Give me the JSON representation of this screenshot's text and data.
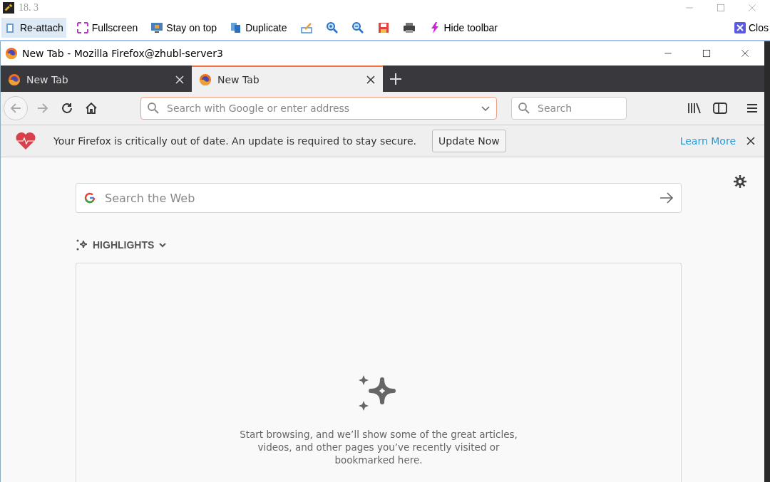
{
  "outer_window": {
    "title": "18. 3"
  },
  "toolbar": {
    "items": [
      {
        "label": "Re-attach",
        "kind": "labeled",
        "highlighted": true
      },
      {
        "label": "Fullscreen",
        "kind": "labeled",
        "highlighted": false
      },
      {
        "label": "Stay on top",
        "kind": "labeled",
        "highlighted": false
      },
      {
        "label": "Duplicate",
        "kind": "labeled",
        "highlighted": false
      },
      {
        "kind": "icon",
        "highlighted": false
      },
      {
        "kind": "icon",
        "highlighted": false
      },
      {
        "kind": "icon",
        "highlighted": false
      },
      {
        "kind": "icon",
        "highlighted": false
      },
      {
        "kind": "icon",
        "highlighted": false
      },
      {
        "label": "Hide toolbar",
        "kind": "labeled",
        "highlighted": false
      }
    ],
    "close_label": "Clos"
  },
  "window": {
    "title": "New Tab - Mozilla Firefox@zhubl-server3"
  },
  "tabs": [
    {
      "label": "New Tab",
      "selected": false
    },
    {
      "label": "New Tab",
      "selected": true
    }
  ],
  "address_bar": {
    "placeholder": "Search with Google or enter address"
  },
  "search_bar": {
    "placeholder": "Search"
  },
  "notification": {
    "message": "Your Firefox is critically out of date. An update is required to stay secure.",
    "button": "Update Now",
    "link": "Learn More"
  },
  "content": {
    "web_search": {
      "placeholder": "Search the Web"
    },
    "highlights": {
      "title": "HIGHLIGHTS",
      "expanded": true,
      "empty_message": "Start browsing, and we’ll show some of the great articles, videos, and other pages you’ve recently visited or bookmarked here."
    }
  }
}
